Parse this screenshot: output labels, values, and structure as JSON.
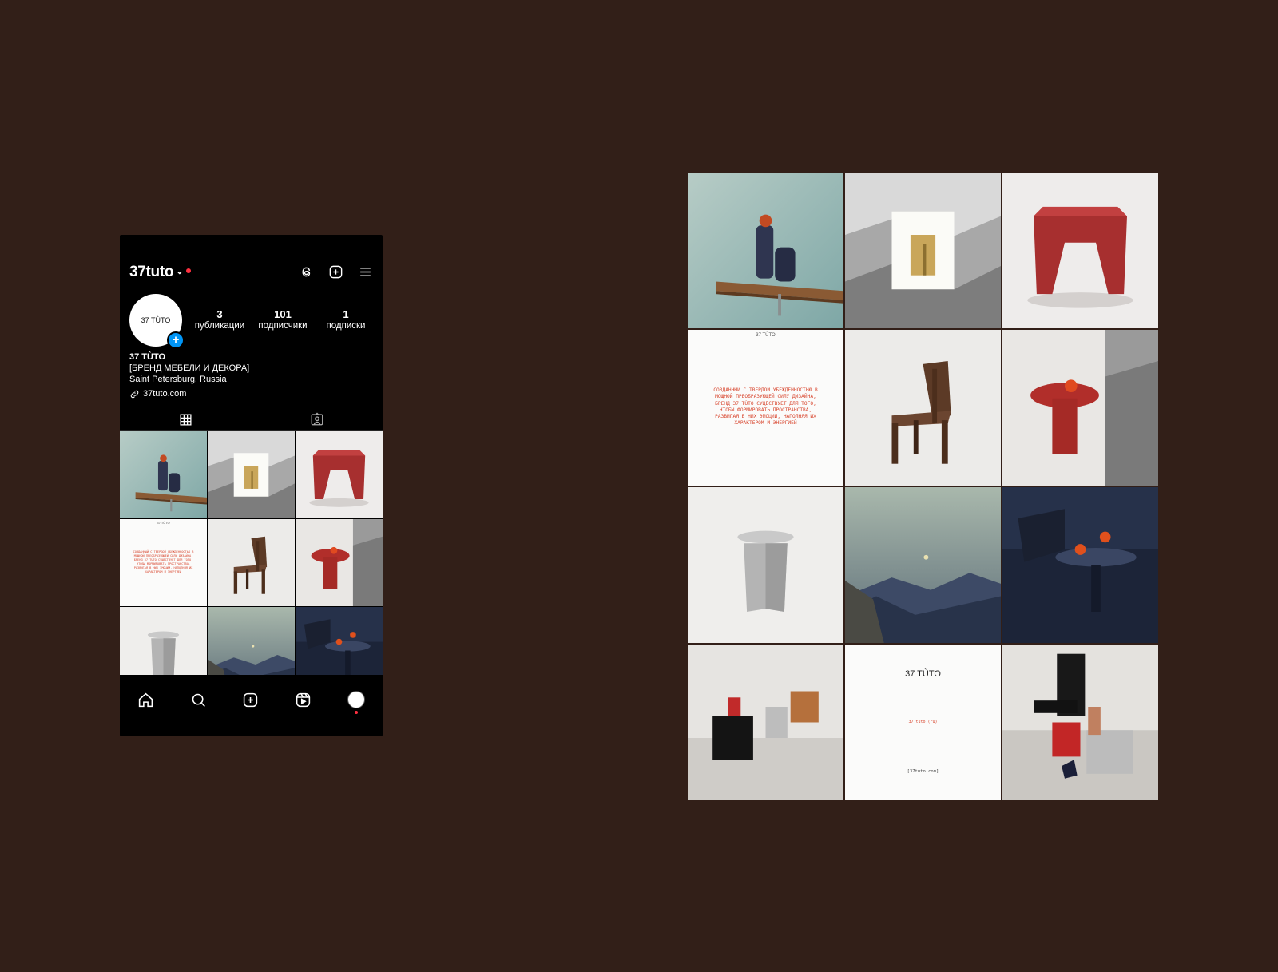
{
  "profile": {
    "username": "37tuto",
    "avatar_text": "37 TÙTO",
    "stats": [
      {
        "value": "3",
        "label": "публикации"
      },
      {
        "value": "101",
        "label": "подписчики"
      },
      {
        "value": "1",
        "label": "подписки"
      }
    ],
    "bio": {
      "name": "37 TÙTO",
      "category": "[БРЕНД МЕБЕЛИ И ДЕКОРА]",
      "location": "Saint Petersburg, Russia",
      "link": "37tuto.com"
    }
  },
  "posts": {
    "manifesto": {
      "brand": "37 TÙTO",
      "text": "Созданный с твердой убежденностью в мощной преобразующей силу дизайна, бренд 37 TÙTO существует для того, чтобы формировать пространства, развигая в них эмоции, наполняя их характером и энергией"
    },
    "cover": {
      "title": "37 TÙTO",
      "subtitle": "37 tuto (ru)",
      "site": "[37tuto.com]"
    }
  },
  "tiles": [
    "shelf-vases",
    "gold-table-mountains",
    "red-stool",
    "manifesto-text",
    "walnut-chair",
    "red-side-table",
    "steel-table",
    "mountain-dusk",
    "dark-table-oranges",
    "furniture-group",
    "brand-cover",
    "collection-group"
  ],
  "colors": {
    "background": "#321f18",
    "accent_blue": "#0095f6",
    "notification_red": "#ff3040",
    "brand_red": "#d8462e"
  },
  "icons": [
    "threads-icon",
    "add-post-icon",
    "menu-icon",
    "grid-icon",
    "tagged-icon",
    "home-icon",
    "search-icon",
    "create-icon",
    "reels-icon"
  ]
}
